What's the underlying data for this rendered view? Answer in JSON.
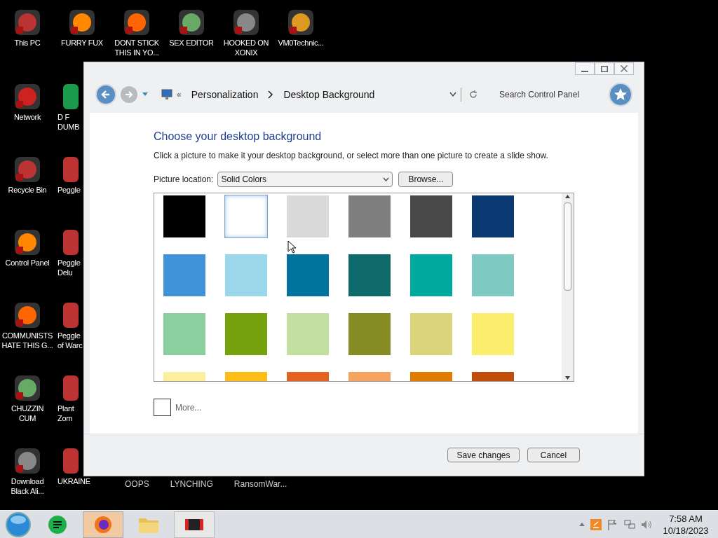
{
  "top_row_icons": [
    {
      "lines": [
        "This PC"
      ]
    },
    {
      "lines": [
        "FURRY FUX"
      ]
    },
    {
      "lines": [
        "DONT STICK",
        "THIS IN YO..."
      ]
    },
    {
      "lines": [
        "SEX EDITOR"
      ]
    },
    {
      "lines": [
        "HOOKED ON",
        "XONIX"
      ]
    },
    {
      "lines": [
        "VM0Technic..."
      ]
    }
  ],
  "left_column_icons": [
    {
      "lines": [
        "Network"
      ]
    },
    {
      "lines": [
        "Recycle Bin"
      ]
    },
    {
      "lines": [
        "Control Panel"
      ]
    },
    {
      "lines": [
        "COMMUNISTS",
        "HATE THIS G..."
      ]
    },
    {
      "lines": [
        "CHUZZIN",
        "CUM"
      ]
    },
    {
      "lines": [
        "Download",
        "Black Ali..."
      ]
    }
  ],
  "covered_icons": [
    {
      "lines": [
        "D F",
        "DUMB"
      ]
    },
    {
      "lines": [
        "Peggle"
      ]
    },
    {
      "lines": [
        "Peggle",
        "Delu"
      ]
    },
    {
      "lines": [
        "Peggle",
        "of Warc"
      ]
    },
    {
      "lines": [
        "Plant",
        "Zom"
      ]
    },
    {
      "lines": [
        "UKRAINE"
      ]
    }
  ],
  "bottom_labels": [
    "OOPS",
    "LYNCHING",
    "RansomWar..."
  ],
  "window": {
    "breadcrumb_overflow": "«",
    "breadcrumb": [
      "Personalization",
      "Desktop Background"
    ],
    "search": {
      "placeholder": "Search Control Panel"
    },
    "heading": "Choose your desktop background",
    "description": "Click a picture to make it your desktop background, or select more than one picture to create a slide show.",
    "location_label": "Picture location:",
    "location_value": "Solid Colors",
    "browse": "Browse...",
    "swatches": [
      {
        "color": "#000000",
        "selected": false
      },
      {
        "color": "#ffffff",
        "selected": true
      },
      {
        "color": "#d9d9d9",
        "selected": false
      },
      {
        "color": "#7f7f7f",
        "selected": false
      },
      {
        "color": "#484848",
        "selected": false
      },
      {
        "color": "#0b3a73",
        "selected": false
      },
      {
        "color": "#4193d9",
        "selected": false
      },
      {
        "color": "#9ad7ea",
        "selected": false
      },
      {
        "color": "#00749f",
        "selected": false
      },
      {
        "color": "#0f6b6b",
        "selected": false
      },
      {
        "color": "#00a99d",
        "selected": false
      },
      {
        "color": "#7ecac3",
        "selected": false
      },
      {
        "color": "#8bcf9e",
        "selected": false
      },
      {
        "color": "#76a30d",
        "selected": false
      },
      {
        "color": "#c4e0a0",
        "selected": false
      },
      {
        "color": "#878b23",
        "selected": false
      },
      {
        "color": "#dad57a",
        "selected": false
      },
      {
        "color": "#fbee6c",
        "selected": false
      },
      {
        "color": "#fcef9b",
        "selected": false
      },
      {
        "color": "#fbbd16",
        "selected": false
      },
      {
        "color": "#e46120",
        "selected": false
      },
      {
        "color": "#f5a35f",
        "selected": false
      },
      {
        "color": "#e07b00",
        "selected": false
      },
      {
        "color": "#c24d0a",
        "selected": false
      }
    ],
    "more": "More...",
    "buttons": [
      "Save changes",
      "Cancel"
    ]
  },
  "clock": {
    "time": "7:58 AM",
    "date": "10/18/2023"
  }
}
